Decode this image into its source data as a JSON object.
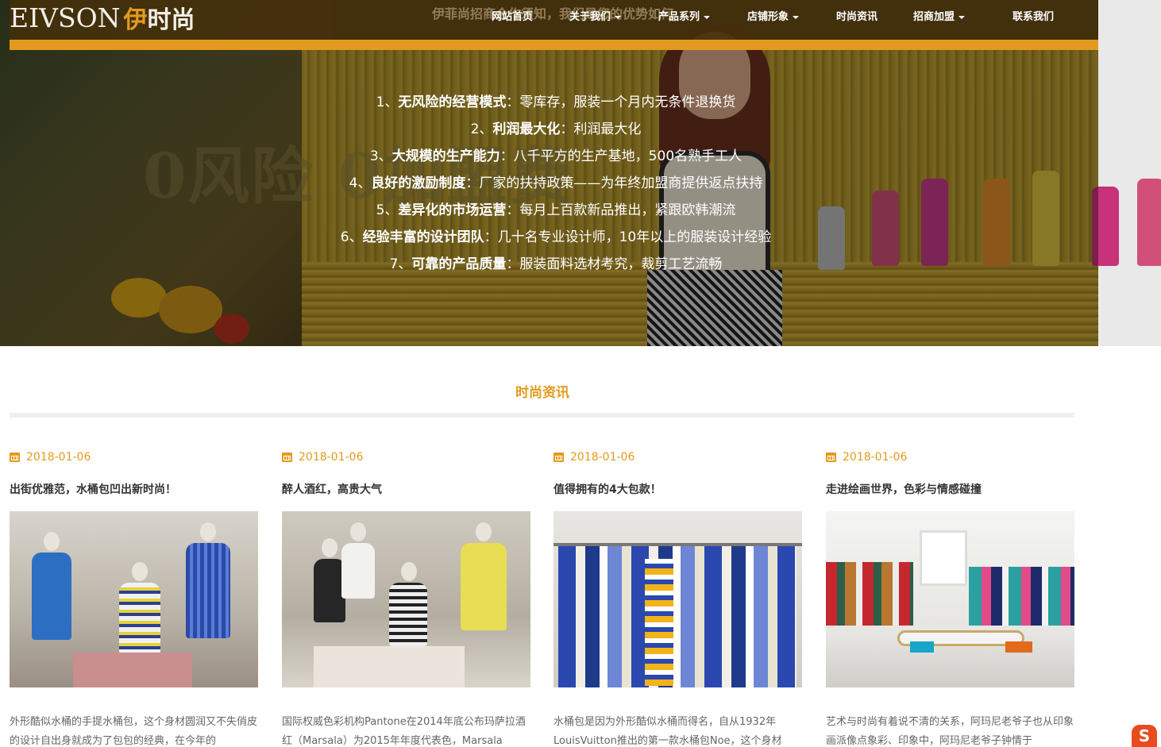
{
  "brand": {
    "logo_en": "EIVSON",
    "logo_cn_first": "伊",
    "logo_cn_rest": "时尚",
    "accent_color": "#e39a1e",
    "nav_bg": "#46300a"
  },
  "nav": {
    "marquee": "伊菲尚招商合作须知，我们是您的优势如何",
    "items": [
      {
        "label": "网站首页",
        "dropdown": false
      },
      {
        "label": "关于我们",
        "dropdown": true
      },
      {
        "label": "产品系列",
        "dropdown": true
      },
      {
        "label": "店铺形象",
        "dropdown": true
      },
      {
        "label": "时尚资讯",
        "dropdown": false
      },
      {
        "label": "招商加盟",
        "dropdown": true
      },
      {
        "label": "联系我们",
        "dropdown": false
      }
    ]
  },
  "hero": {
    "background_words": "0风险 0加盟费",
    "lines": [
      {
        "prefix": "1、",
        "bold": "无风险的经营模式",
        "text": "：零库存，服装一个月内无条件退换货"
      },
      {
        "prefix": "2、",
        "bold": "利润最大化",
        "text": "：利润最大化"
      },
      {
        "prefix": "3、",
        "bold": "大规模的生产能力",
        "text": "：八千平方的生产基地，500名熟手工人"
      },
      {
        "prefix": "4、",
        "bold": "良好的激励制度",
        "text": "：厂家的扶持政策——为年终加盟商提供返点扶持"
      },
      {
        "prefix": "5、",
        "bold": "差异化的市场运营",
        "text": "：每月上百款新品推出，紧跟欧韩潮流"
      },
      {
        "prefix": "6、",
        "bold": "经验丰富的设计团队",
        "text": "：几十名专业设计师，10年以上的服装设计经验"
      },
      {
        "prefix": "7、",
        "bold": "可靠的产品质量",
        "text": "：服装面料选材考究，裁剪工艺流畅"
      }
    ]
  },
  "section": {
    "title": "时尚资讯"
  },
  "articles": [
    {
      "date": "2018-01-06",
      "title": "出街优雅范，水桶包凹出新时尚！",
      "summary": "外形酷似水桶的手提水桶包，这个身材圆润又不失俏皮的设计自出身就成为了包包的经典，在今年的"
    },
    {
      "date": "2018-01-06",
      "title": "醉人酒红，高贵大气",
      "summary": "国际权威色彩机构Pantone在2014年底公布玛萨拉酒红（Marsala）为2015年年度代表色，Marsala"
    },
    {
      "date": "2018-01-06",
      "title": "值得拥有的4大包款！",
      "summary": "水桶包是因为外形酷似水桶而得名，自从1932年LouisVuitton推出的第一款水桶包Noe，这个身材"
    },
    {
      "date": "2018-01-06",
      "title": "走进绘画世界，色彩与情感碰撞",
      "summary": "艺术与时尚有着说不清的关系，阿玛尼老爷子也从印象画派像点象彩、印象中，阿玛尼老爷子钟情于"
    }
  ],
  "widget": {
    "label": "S"
  }
}
